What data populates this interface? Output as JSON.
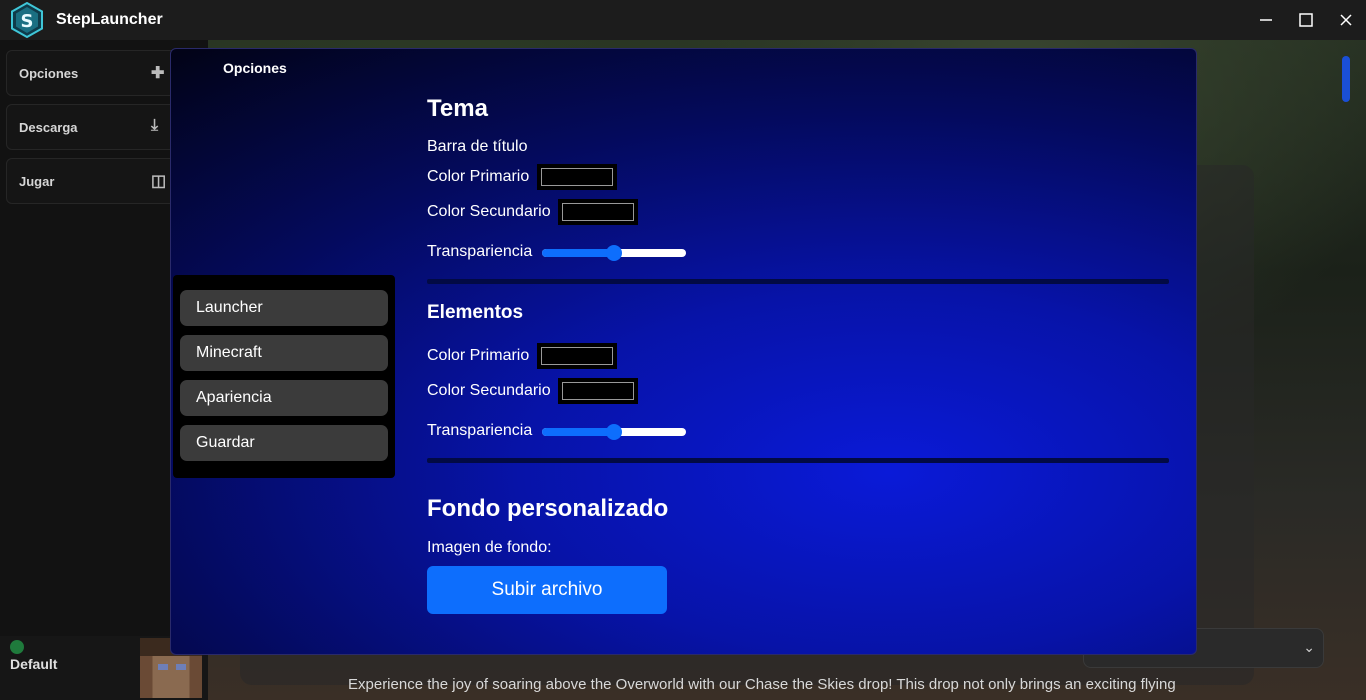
{
  "window": {
    "title": "StepLauncher",
    "controls": {
      "minimize": "—",
      "maximize": "☐",
      "close": "✕"
    }
  },
  "sidebar": {
    "items": [
      {
        "label": "Opciones",
        "icon": "puzzle-icon"
      },
      {
        "label": "Descarga",
        "icon": "download-icon"
      },
      {
        "label": "Jugar",
        "icon": "gamepad-icon"
      }
    ],
    "profile": {
      "name": "Default",
      "status_color": "#1f7a3c"
    }
  },
  "background": {
    "text": "Experience the joy of soaring above the Overworld with our Chase the Skies drop! This drop not only brings an exciting flying"
  },
  "modal": {
    "title": "Opciones",
    "menu": [
      {
        "label": "Launcher"
      },
      {
        "label": "Minecraft"
      },
      {
        "label": "Apariencia"
      },
      {
        "label": "Guardar"
      }
    ],
    "tema": {
      "heading": "Tema",
      "subheading": "Barra de título",
      "primary_label": "Color Primario",
      "primary_value": "#000000",
      "secondary_label": "Color Secundario",
      "secondary_value": "#000000",
      "transparency_label": "Transpariencia",
      "transparency_value": 0.5
    },
    "elementos": {
      "heading": "Elementos",
      "primary_label": "Color Primario",
      "primary_value": "#000000",
      "secondary_label": "Color Secundario",
      "secondary_value": "#000000",
      "transparency_label": "Transpariencia",
      "transparency_value": 0.5
    },
    "fondo": {
      "heading": "Fondo personalizado",
      "label": "Imagen de fondo:",
      "button": "Subir archivo"
    }
  },
  "colors": {
    "accent": "#0d6efd",
    "modal_bg": "#0713a8"
  }
}
